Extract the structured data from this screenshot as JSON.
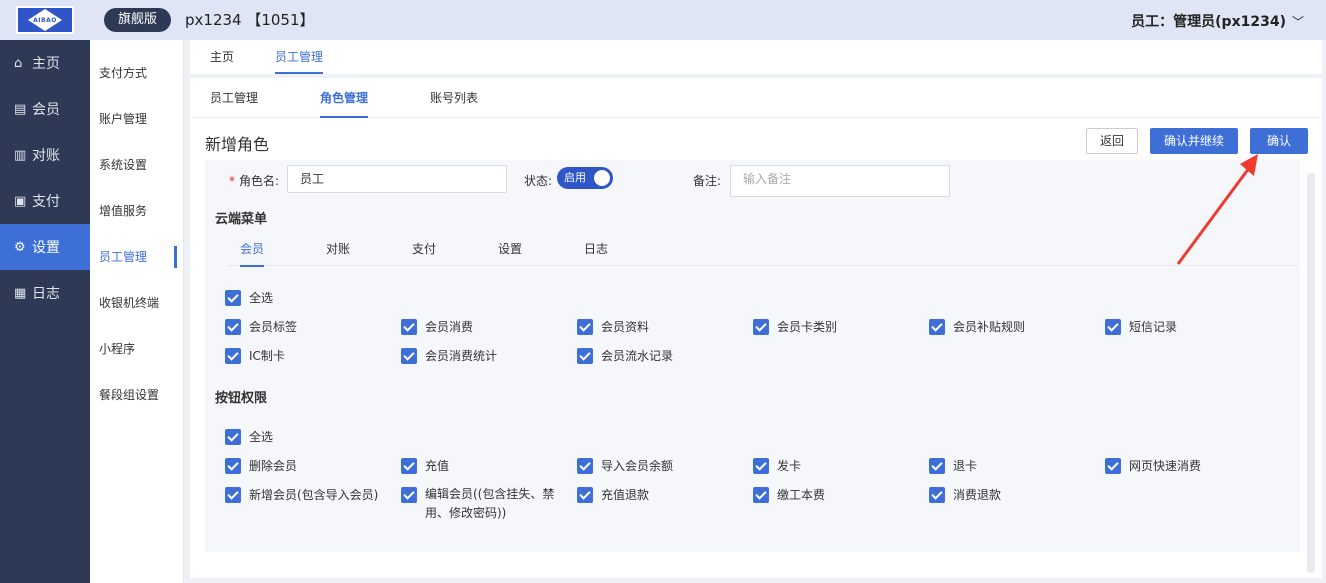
{
  "header": {
    "logo_text": "AIBAO",
    "edition": "旗舰版",
    "shop": "px1234 【1051】",
    "user": "员工：管理员(px1234)",
    "chevron": "﹀"
  },
  "nav": [
    {
      "label": "主页",
      "icon": "home-icon"
    },
    {
      "label": "会员",
      "icon": "member-icon"
    },
    {
      "label": "对账",
      "icon": "reconcile-icon"
    },
    {
      "label": "支付",
      "icon": "pay-icon"
    },
    {
      "label": "设置",
      "icon": "gear-icon"
    },
    {
      "label": "日志",
      "icon": "log-icon"
    }
  ],
  "submenu": [
    "支付方式",
    "账户管理",
    "系统设置",
    "增值服务",
    "员工管理",
    "收银机终端",
    "小程序",
    "餐段组设置"
  ],
  "tabs": [
    "主页",
    "员工管理"
  ],
  "subtabs": [
    "员工管理",
    "角色管理",
    "账号列表"
  ],
  "page": {
    "title": "新增角色",
    "back": "返回",
    "confirm_continue": "确认并继续",
    "confirm": "确认"
  },
  "form": {
    "role_label": "角色名:",
    "role_required": "*",
    "role_value": "员工",
    "status_label": "状态:",
    "status_value": "启用",
    "remark_label": "备注:",
    "remark_placeholder": "输入备注"
  },
  "cloud_menu": {
    "title": "云端菜单",
    "tabs": [
      "会员",
      "对账",
      "支付",
      "设置",
      "日志"
    ],
    "select_all": "全选",
    "items": [
      "会员标签",
      "会员消费",
      "会员资料",
      "会员卡类别",
      "会员补贴规则",
      "短信记录",
      "IC制卡",
      "会员消费统计",
      "会员流水记录"
    ]
  },
  "button_perms": {
    "title": "按钮权限",
    "select_all": "全选",
    "items": [
      "删除会员",
      "充值",
      "导入会员余额",
      "发卡",
      "退卡",
      "网页快速消费",
      "新增会员(包含导入会员)",
      "编辑会员((包含挂失、禁用、修改密码))",
      "充值退款",
      "缴工本费",
      "消费退款"
    ]
  },
  "colors": {
    "accent": "#3d6fd6",
    "nav_bg": "#2e3a55",
    "arrow": "#f03a2e"
  }
}
